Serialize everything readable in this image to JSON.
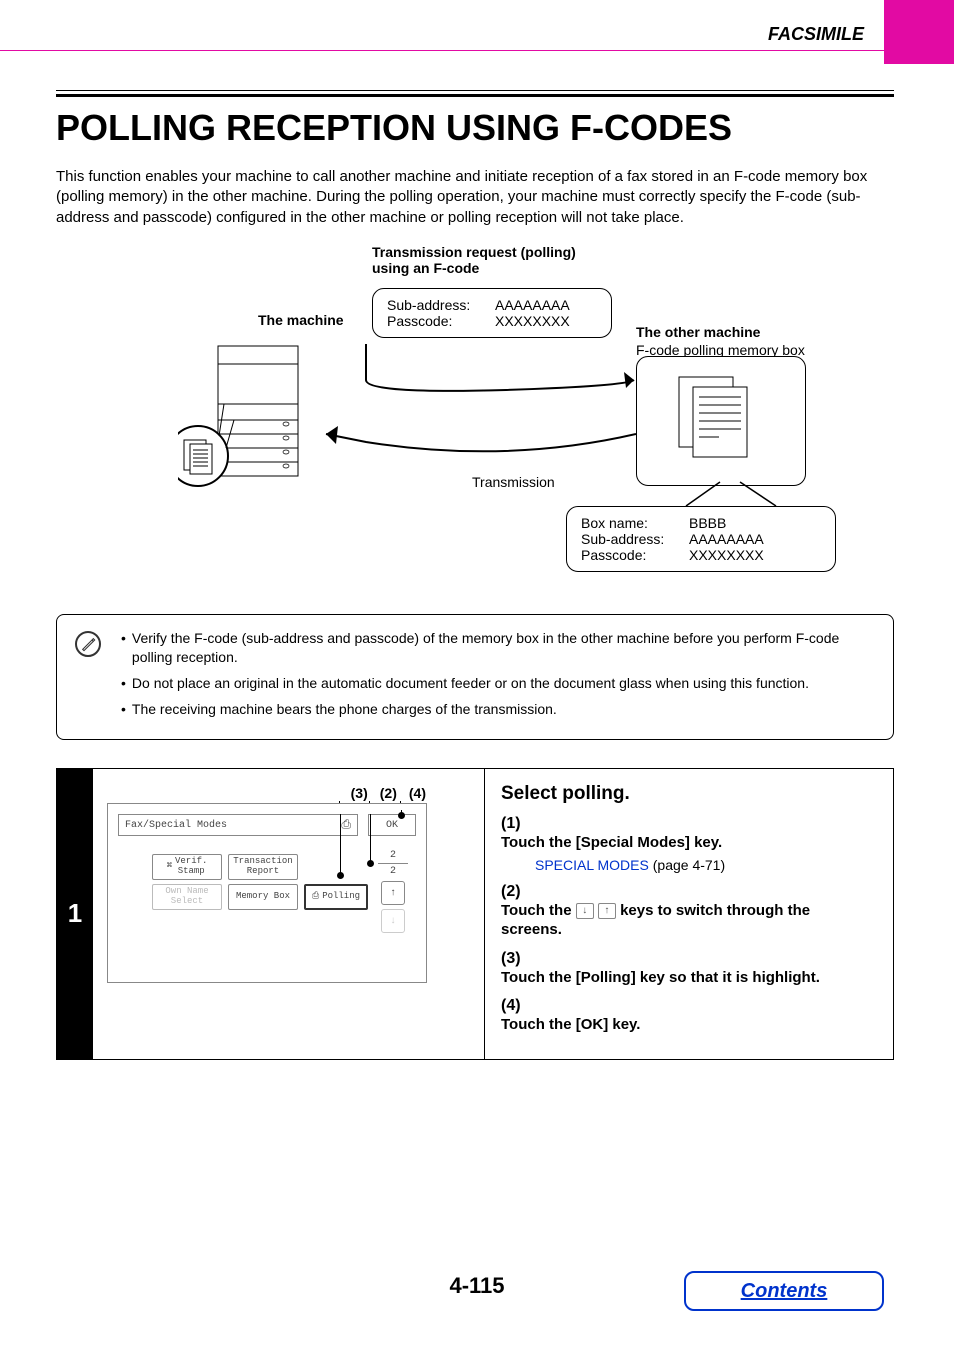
{
  "header": {
    "category": "FACSIMILE"
  },
  "main": {
    "title": "POLLING RECEPTION USING F-CODES",
    "intro": "This function enables your machine to call another machine and initiate reception of a fax stored in an F-code memory box (polling memory) in the other machine. During the polling operation, your machine must correctly specify the F-code (sub-address and passcode) configured in the other machine or polling reception will not take place."
  },
  "diagram": {
    "caption_line1": "Transmission request (polling)",
    "caption_line2": "using an F-code",
    "machine_label": "The machine",
    "other_machine_label": "The other machine",
    "other_machine_sub": "F-code polling memory box",
    "transmission_label": "Transmission",
    "top_box": {
      "sub_address_label": "Sub-address:",
      "sub_address_value": "AAAAAAAA",
      "passcode_label": "Passcode:",
      "passcode_value": "XXXXXXXX"
    },
    "bottom_box": {
      "box_name_label": "Box name:",
      "box_name_value": "BBBB",
      "sub_address_label": "Sub-address:",
      "sub_address_value": "AAAAAAAA",
      "passcode_label": "Passcode:",
      "passcode_value": "XXXXXXXX"
    }
  },
  "notes": {
    "items": [
      "Verify the F-code (sub-address and passcode) of the memory box in the other machine before you perform F-code polling reception.",
      "Do not place an original in the automatic document feeder or on the document glass when using this function.",
      "The receiving machine bears the phone charges of the transmission."
    ]
  },
  "step": {
    "number": "1",
    "callouts": {
      "c1": "(3)",
      "c2": "(2)",
      "c3": "(4)"
    },
    "screen": {
      "title": "Fax/Special Modes",
      "ok": "OK",
      "btn_verif": "Verif.\nStamp",
      "btn_trans": "Transaction\nReport",
      "btn_own": "Own Name\nSelect",
      "btn_memory": "Memory Box",
      "btn_polling": "Polling",
      "pager_current": "2",
      "pager_total": "2"
    },
    "text": {
      "heading": "Select polling.",
      "items": [
        {
          "num": "(1)",
          "main": "Touch the [Special Modes] key.",
          "link_text": "SPECIAL MODES",
          "link_suffix": " (page 4-71)"
        },
        {
          "num": "(2)",
          "main_before": "Touch the ",
          "main_after": " keys to switch through the screens."
        },
        {
          "num": "(3)",
          "main": "Touch the [Polling] key so that it is highlight."
        },
        {
          "num": "(4)",
          "main": "Touch the [OK] key."
        }
      ]
    }
  },
  "footer": {
    "page": "4-115",
    "contents": "Contents"
  }
}
